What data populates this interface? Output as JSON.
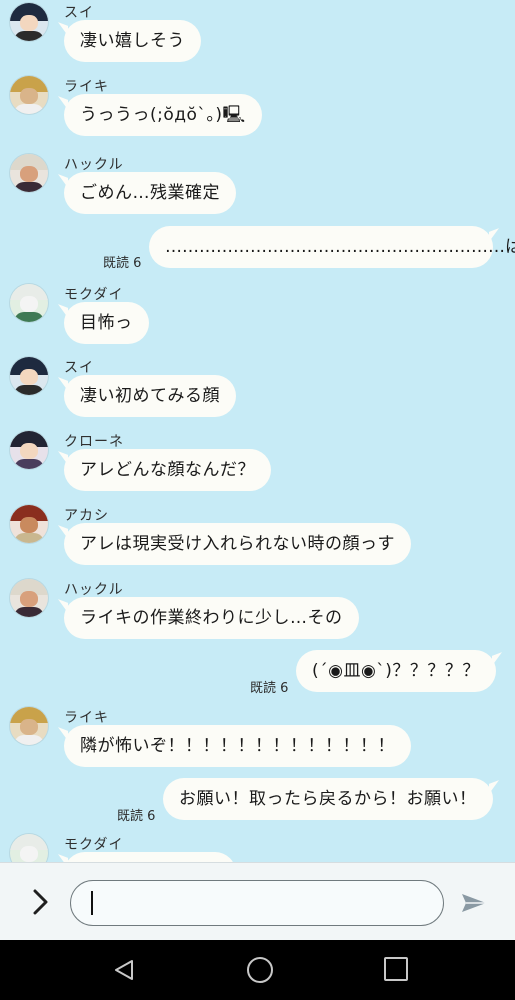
{
  "messages": [
    {
      "sender": "スイ",
      "text": "凄い嬉しそう",
      "side": "in"
    },
    {
      "sender": "ライキ",
      "text": "うっうっ(;ŏдŏ`。)🖳",
      "side": "in"
    },
    {
      "sender": "ハックル",
      "text": "ごめん…残業確定",
      "side": "in"
    },
    {
      "text": "……………………………………………………は？",
      "side": "out",
      "read": "既読 6"
    },
    {
      "sender": "モクダイ",
      "text": "目怖っ",
      "side": "in"
    },
    {
      "sender": "スイ",
      "text": "凄い初めてみる顔",
      "side": "in"
    },
    {
      "sender": "クローネ",
      "text": "アレどんな顔なんだ？",
      "side": "in"
    },
    {
      "sender": "アカシ",
      "text": "アレは現実受け入れられない時の顔っす",
      "side": "in"
    },
    {
      "sender": "ハックル",
      "text": "ライキの作業終わりに少し…その",
      "side": "in"
    },
    {
      "text": "(´◉皿◉`)？？？？？",
      "side": "out",
      "read": "既読 6"
    },
    {
      "sender": "ライキ",
      "text": "隣が怖いぞ！！！！！！！！！！！！！",
      "side": "in"
    },
    {
      "text": "お願い！取ったら戻るから！お願い！",
      "side": "out",
      "read": "既読 6"
    },
    {
      "sender": "モクダイ",
      "text": "",
      "side": "in"
    }
  ],
  "input": {
    "value": ""
  },
  "icons": {
    "expand": "chevron-right-icon",
    "send": "send-icon",
    "back": "nav-back-icon",
    "home": "nav-home-icon",
    "recent": "nav-recent-icon"
  },
  "colors": {
    "background": "#c7ebf6",
    "bubble": "#fcfcf7"
  }
}
